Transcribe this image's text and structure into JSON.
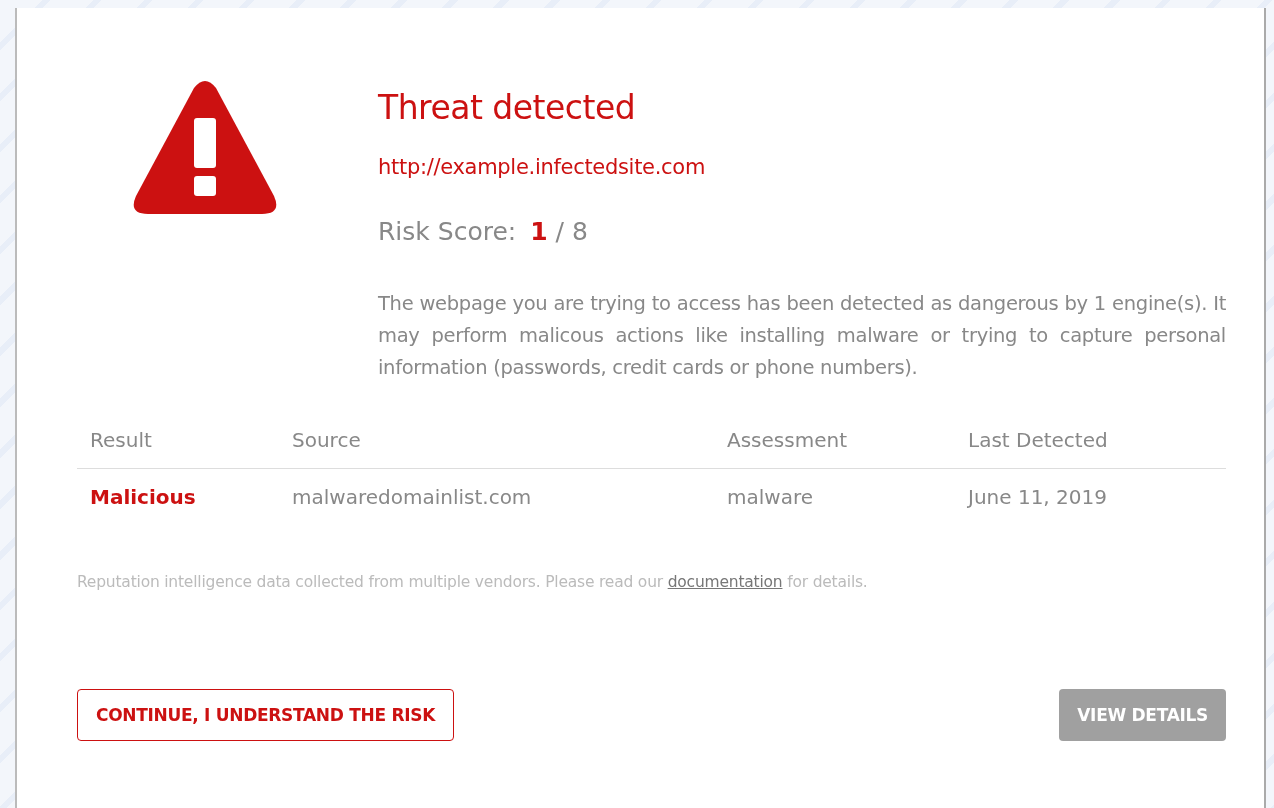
{
  "alert": {
    "title": "Threat detected",
    "url": "http://example.infectedsite.com",
    "risk": {
      "label": "Risk Score:",
      "score": "1",
      "total": "/ 8"
    },
    "description": "The webpage you are trying to access has been detected as dangerous by 1 engine(s). It may perform malicous actions like installing malware or trying to capture personal information (passwords, credit cards or phone numbers)."
  },
  "table": {
    "columns": [
      "Result",
      "Source",
      "Assessment",
      "Last Detected"
    ],
    "rows": [
      [
        "Malicious",
        "malwaredomainlist.com",
        "malware",
        "June 11, 2019"
      ]
    ]
  },
  "footnote": {
    "before": "Reputation intelligence data collected from multiple vendors. Please read our",
    "link": "documentation",
    "after": "for details."
  },
  "buttons": [
    {
      "label": "CONTINUE, I UNDERSTAND THE RISK",
      "kind": "outline"
    },
    {
      "label": "VIEW DETAILS",
      "kind": "filled"
    }
  ]
}
